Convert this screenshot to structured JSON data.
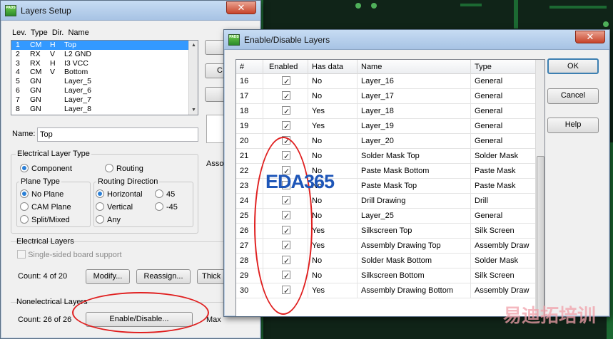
{
  "layers_setup": {
    "title": "Layers Setup",
    "close_label": "✕",
    "columns_header": "Lev.  Type  Dir.  Name",
    "layers": [
      {
        "lev": "1",
        "type": "CM",
        "dir": "H",
        "name": "Top"
      },
      {
        "lev": "2",
        "type": "RX",
        "dir": "V",
        "name": "L2 GND"
      },
      {
        "lev": "3",
        "type": "RX",
        "dir": "H",
        "name": "I3 VCC"
      },
      {
        "lev": "4",
        "type": "CM",
        "dir": "V",
        "name": "Bottom"
      },
      {
        "lev": "5",
        "type": "GN",
        "dir": "",
        "name": "Layer_5"
      },
      {
        "lev": "6",
        "type": "GN",
        "dir": "",
        "name": "Layer_6"
      },
      {
        "lev": "7",
        "type": "GN",
        "dir": "",
        "name": "Layer_7"
      },
      {
        "lev": "8",
        "type": "GN",
        "dir": "",
        "name": "Layer_8"
      }
    ],
    "name_label": "Name:",
    "name_value": "Top",
    "electrical_layer_type_label": "Electrical Layer Type",
    "component_label": "Component",
    "routing_label": "Routing",
    "plane_type_label": "Plane Type",
    "no_plane_label": "No Plane",
    "cam_plane_label": "CAM Plane",
    "split_mixed_label": "Split/Mixed",
    "routing_direction_label": "Routing Direction",
    "horizontal_label": "Horizontal",
    "vertical_label": "Vertical",
    "any_label": "Any",
    "deg45_label": "45",
    "degm45_label": "-45",
    "electrical_layers_label": "Electrical Layers",
    "single_sided_label": "Single-sided board support",
    "count_electrical": "Count:  4 of 20",
    "modify_label": "Modify...",
    "reassign_label": "Reassign...",
    "thickness_label": "Thick",
    "nonelectrical_label": "Nonelectrical Layers",
    "count_nonelectrical": "Count:  26 of 26",
    "enable_disable_label": "Enable/Disable...",
    "max_label": "Max",
    "side_btn_c": "C",
    "assoc_label": "Asso"
  },
  "enable_disable": {
    "title": "Enable/Disable Layers",
    "close_label": "✕",
    "columns": [
      "#",
      "Enabled",
      "Has data",
      "Name",
      "Type"
    ],
    "rows": [
      {
        "num": "16",
        "enabled": true,
        "has_data": "No",
        "name": "Layer_16",
        "type": "General"
      },
      {
        "num": "17",
        "enabled": true,
        "has_data": "No",
        "name": "Layer_17",
        "type": "General"
      },
      {
        "num": "18",
        "enabled": true,
        "has_data": "Yes",
        "name": "Layer_18",
        "type": "General"
      },
      {
        "num": "19",
        "enabled": true,
        "has_data": "Yes",
        "name": "Layer_19",
        "type": "General"
      },
      {
        "num": "20",
        "enabled": true,
        "has_data": "No",
        "name": "Layer_20",
        "type": "General"
      },
      {
        "num": "21",
        "enabled": true,
        "has_data": "No",
        "name": "Solder Mask Top",
        "type": "Solder Mask"
      },
      {
        "num": "22",
        "enabled": true,
        "has_data": "No",
        "name": "Paste Mask Bottom",
        "type": "Paste Mask"
      },
      {
        "num": "23",
        "enabled": true,
        "has_data": "No",
        "name": "Paste Mask Top",
        "type": "Paste Mask"
      },
      {
        "num": "24",
        "enabled": true,
        "has_data": "No",
        "name": "Drill Drawing",
        "type": "Drill"
      },
      {
        "num": "25",
        "enabled": true,
        "has_data": "No",
        "name": "Layer_25",
        "type": "General"
      },
      {
        "num": "26",
        "enabled": true,
        "has_data": "Yes",
        "name": "Silkscreen Top",
        "type": "Silk Screen"
      },
      {
        "num": "27",
        "enabled": true,
        "has_data": "Yes",
        "name": "Assembly Drawing Top",
        "type": "Assembly Draw"
      },
      {
        "num": "28",
        "enabled": true,
        "has_data": "No",
        "name": "Solder Mask Bottom",
        "type": "Solder Mask"
      },
      {
        "num": "29",
        "enabled": true,
        "has_data": "No",
        "name": "Silkscreen Bottom",
        "type": "Silk Screen"
      },
      {
        "num": "30",
        "enabled": true,
        "has_data": "Yes",
        "name": "Assembly Drawing Bottom",
        "type": "Assembly Draw"
      }
    ],
    "ok_label": "OK",
    "cancel_label": "Cancel",
    "help_label": "Help"
  },
  "watermarks": {
    "eda365": "EDA365",
    "corner_text": "易迪拓培训"
  },
  "colors": {
    "selection": "#3399ff",
    "annotation_red": "#e02020",
    "eda_blue": "#1e56b8"
  }
}
